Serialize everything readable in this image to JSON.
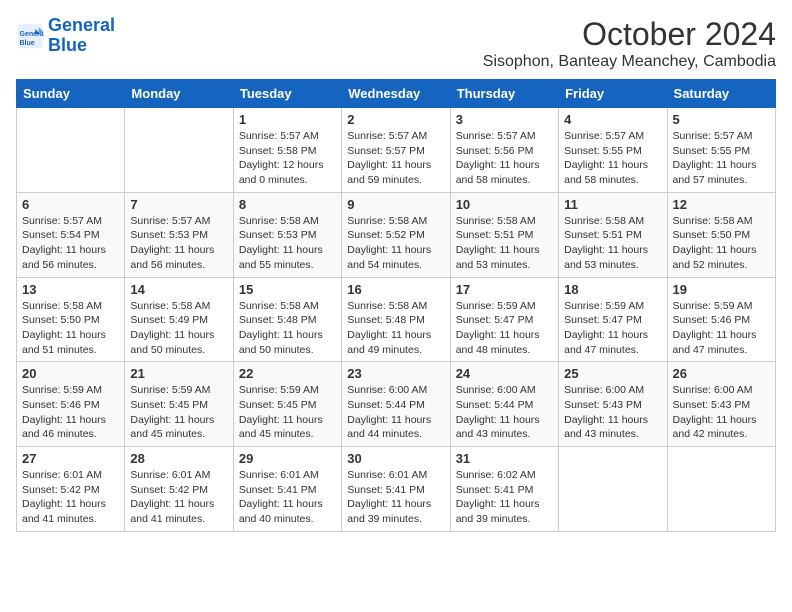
{
  "header": {
    "logo_line1": "General",
    "logo_line2": "Blue",
    "month": "October 2024",
    "location": "Sisophon, Banteay Meanchey, Cambodia"
  },
  "weekdays": [
    "Sunday",
    "Monday",
    "Tuesday",
    "Wednesday",
    "Thursday",
    "Friday",
    "Saturday"
  ],
  "weeks": [
    [
      {
        "day": "",
        "info": ""
      },
      {
        "day": "",
        "info": ""
      },
      {
        "day": "1",
        "info": "Sunrise: 5:57 AM\nSunset: 5:58 PM\nDaylight: 12 hours\nand 0 minutes."
      },
      {
        "day": "2",
        "info": "Sunrise: 5:57 AM\nSunset: 5:57 PM\nDaylight: 11 hours\nand 59 minutes."
      },
      {
        "day": "3",
        "info": "Sunrise: 5:57 AM\nSunset: 5:56 PM\nDaylight: 11 hours\nand 58 minutes."
      },
      {
        "day": "4",
        "info": "Sunrise: 5:57 AM\nSunset: 5:55 PM\nDaylight: 11 hours\nand 58 minutes."
      },
      {
        "day": "5",
        "info": "Sunrise: 5:57 AM\nSunset: 5:55 PM\nDaylight: 11 hours\nand 57 minutes."
      }
    ],
    [
      {
        "day": "6",
        "info": "Sunrise: 5:57 AM\nSunset: 5:54 PM\nDaylight: 11 hours\nand 56 minutes."
      },
      {
        "day": "7",
        "info": "Sunrise: 5:57 AM\nSunset: 5:53 PM\nDaylight: 11 hours\nand 56 minutes."
      },
      {
        "day": "8",
        "info": "Sunrise: 5:58 AM\nSunset: 5:53 PM\nDaylight: 11 hours\nand 55 minutes."
      },
      {
        "day": "9",
        "info": "Sunrise: 5:58 AM\nSunset: 5:52 PM\nDaylight: 11 hours\nand 54 minutes."
      },
      {
        "day": "10",
        "info": "Sunrise: 5:58 AM\nSunset: 5:51 PM\nDaylight: 11 hours\nand 53 minutes."
      },
      {
        "day": "11",
        "info": "Sunrise: 5:58 AM\nSunset: 5:51 PM\nDaylight: 11 hours\nand 53 minutes."
      },
      {
        "day": "12",
        "info": "Sunrise: 5:58 AM\nSunset: 5:50 PM\nDaylight: 11 hours\nand 52 minutes."
      }
    ],
    [
      {
        "day": "13",
        "info": "Sunrise: 5:58 AM\nSunset: 5:50 PM\nDaylight: 11 hours\nand 51 minutes."
      },
      {
        "day": "14",
        "info": "Sunrise: 5:58 AM\nSunset: 5:49 PM\nDaylight: 11 hours\nand 50 minutes."
      },
      {
        "day": "15",
        "info": "Sunrise: 5:58 AM\nSunset: 5:48 PM\nDaylight: 11 hours\nand 50 minutes."
      },
      {
        "day": "16",
        "info": "Sunrise: 5:58 AM\nSunset: 5:48 PM\nDaylight: 11 hours\nand 49 minutes."
      },
      {
        "day": "17",
        "info": "Sunrise: 5:59 AM\nSunset: 5:47 PM\nDaylight: 11 hours\nand 48 minutes."
      },
      {
        "day": "18",
        "info": "Sunrise: 5:59 AM\nSunset: 5:47 PM\nDaylight: 11 hours\nand 47 minutes."
      },
      {
        "day": "19",
        "info": "Sunrise: 5:59 AM\nSunset: 5:46 PM\nDaylight: 11 hours\nand 47 minutes."
      }
    ],
    [
      {
        "day": "20",
        "info": "Sunrise: 5:59 AM\nSunset: 5:46 PM\nDaylight: 11 hours\nand 46 minutes."
      },
      {
        "day": "21",
        "info": "Sunrise: 5:59 AM\nSunset: 5:45 PM\nDaylight: 11 hours\nand 45 minutes."
      },
      {
        "day": "22",
        "info": "Sunrise: 5:59 AM\nSunset: 5:45 PM\nDaylight: 11 hours\nand 45 minutes."
      },
      {
        "day": "23",
        "info": "Sunrise: 6:00 AM\nSunset: 5:44 PM\nDaylight: 11 hours\nand 44 minutes."
      },
      {
        "day": "24",
        "info": "Sunrise: 6:00 AM\nSunset: 5:44 PM\nDaylight: 11 hours\nand 43 minutes."
      },
      {
        "day": "25",
        "info": "Sunrise: 6:00 AM\nSunset: 5:43 PM\nDaylight: 11 hours\nand 43 minutes."
      },
      {
        "day": "26",
        "info": "Sunrise: 6:00 AM\nSunset: 5:43 PM\nDaylight: 11 hours\nand 42 minutes."
      }
    ],
    [
      {
        "day": "27",
        "info": "Sunrise: 6:01 AM\nSunset: 5:42 PM\nDaylight: 11 hours\nand 41 minutes."
      },
      {
        "day": "28",
        "info": "Sunrise: 6:01 AM\nSunset: 5:42 PM\nDaylight: 11 hours\nand 41 minutes."
      },
      {
        "day": "29",
        "info": "Sunrise: 6:01 AM\nSunset: 5:41 PM\nDaylight: 11 hours\nand 40 minutes."
      },
      {
        "day": "30",
        "info": "Sunrise: 6:01 AM\nSunset: 5:41 PM\nDaylight: 11 hours\nand 39 minutes."
      },
      {
        "day": "31",
        "info": "Sunrise: 6:02 AM\nSunset: 5:41 PM\nDaylight: 11 hours\nand 39 minutes."
      },
      {
        "day": "",
        "info": ""
      },
      {
        "day": "",
        "info": ""
      }
    ]
  ]
}
